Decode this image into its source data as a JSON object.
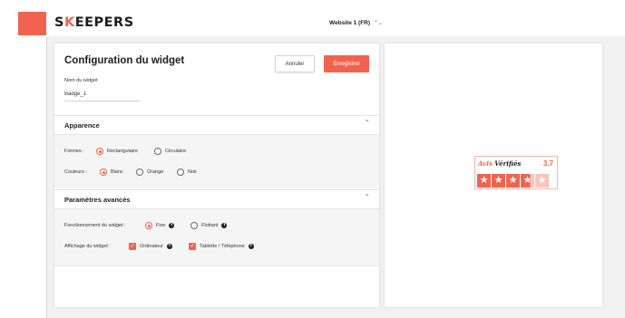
{
  "header": {
    "brand": {
      "s": "S",
      "k": "K",
      "rest": "EEPERS"
    },
    "site_select": {
      "value": "Website 1 (FR)",
      "chevron": "⌃⌄"
    },
    "accent_color": "#f2634f"
  },
  "config": {
    "title": "Configuration du widget",
    "cancel_label": "Annuler",
    "save_label": "Enregistrer",
    "widget_name_label": "Nom du widget",
    "widget_name_value": "Badge_1"
  },
  "appearance": {
    "title": "Apparence",
    "forms_label": "Formes :",
    "forms_options": [
      {
        "label": "Rectangulaire",
        "selected": true
      },
      {
        "label": "Circulaire",
        "selected": false
      }
    ],
    "colors_label": "Couleurs :",
    "colors_options": [
      {
        "label": "Blanc",
        "selected": true
      },
      {
        "label": "Orange",
        "selected": false
      },
      {
        "label": "Noir",
        "selected": false
      }
    ]
  },
  "advanced": {
    "title": "Paramètres avancés",
    "behaviour_label": "Fonctionnement du widget :",
    "behaviour_options": [
      {
        "label": "Fixe",
        "selected": true
      },
      {
        "label": "Flottant",
        "selected": false
      }
    ],
    "display_label": "Affichage du widget :",
    "display_options": [
      {
        "label": "Ordinateur",
        "checked": true
      },
      {
        "label": "Tablette / Téléphone",
        "checked": true
      }
    ]
  },
  "preview": {
    "badge_brand": {
      "part1": "Avis",
      "part2": "Vérifiés"
    },
    "score": "3.7",
    "rating": 3.7,
    "max_stars": 5
  }
}
